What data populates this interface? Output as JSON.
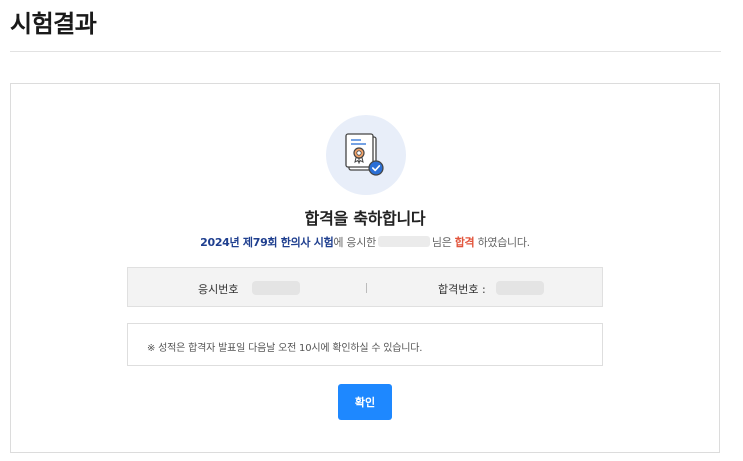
{
  "page": {
    "title": "시험결과"
  },
  "result": {
    "headline": "합격을 축하합니다",
    "message": {
      "exam_name": "2024년 제79회 한의사 시험",
      "part_applied": "에 응시한",
      "part_suffix": "님은",
      "pass_word": "합격",
      "part_end": "하였습니다."
    },
    "info": {
      "applicant_no_label": "응시번호",
      "pass_no_label": "합격번호 :"
    },
    "notice": "※ 성적은 합격자 발표일 다음날 오전 10시에 확인하실 수 있습니다.",
    "confirm_label": "확인"
  },
  "icons": {
    "certificate": "certificate-icon"
  },
  "colors": {
    "accent": "#1e88ff",
    "exam_name": "#1f3f8f",
    "pass": "#e2553c",
    "icon_bg": "#e8eef9"
  }
}
